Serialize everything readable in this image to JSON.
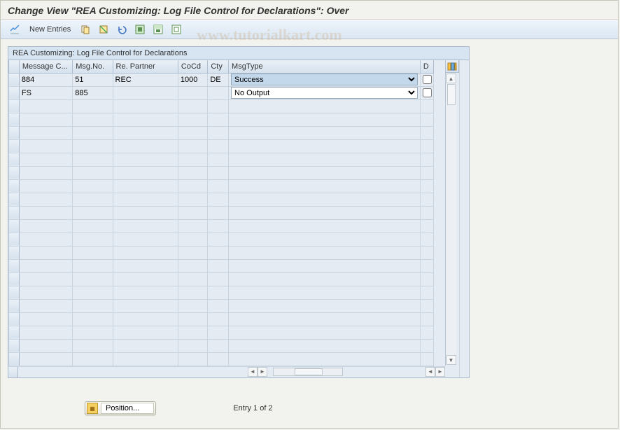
{
  "header": {
    "title": "Change View \"REA Customizing: Log File Control for Declarations\": Over"
  },
  "toolbar": {
    "new_entries": "New Entries"
  },
  "panel": {
    "title": "REA Customizing: Log File Control for Declarations"
  },
  "columns": {
    "msg_class": "Message C...",
    "msg_no": "Msg.No.",
    "re_partner": "Re. Partner",
    "cocd": "CoCd",
    "cty": "Cty",
    "msgtype": "MsgType",
    "d": "D"
  },
  "msgtype_options": {
    "success": "Success",
    "no_output": "No Output"
  },
  "rows": [
    {
      "msg_class": "884",
      "msg_no": "51",
      "re_partner": "REC",
      "cocd": "1000",
      "cty": "DE",
      "msgtype": "Success",
      "d": false
    },
    {
      "msg_class": "FS",
      "msg_no": "885",
      "re_partner": "",
      "cocd": "",
      "cty": "",
      "msgtype": "No Output",
      "d": false
    }
  ],
  "footer": {
    "position_label": "Position...",
    "entry_text": "Entry 1 of 2"
  },
  "watermark": "www.tutorialkart.com",
  "chart_data": {
    "type": "table",
    "title": "REA Customizing: Log File Control for Declarations",
    "columns": [
      "Message Class",
      "Msg.No.",
      "Re. Partner",
      "CoCd",
      "Cty",
      "MsgType",
      "D"
    ],
    "rows": [
      [
        "884",
        "51",
        "REC",
        "1000",
        "DE",
        "Success",
        false
      ],
      [
        "FS",
        "885",
        "",
        "",
        "",
        "No Output",
        false
      ]
    ]
  }
}
